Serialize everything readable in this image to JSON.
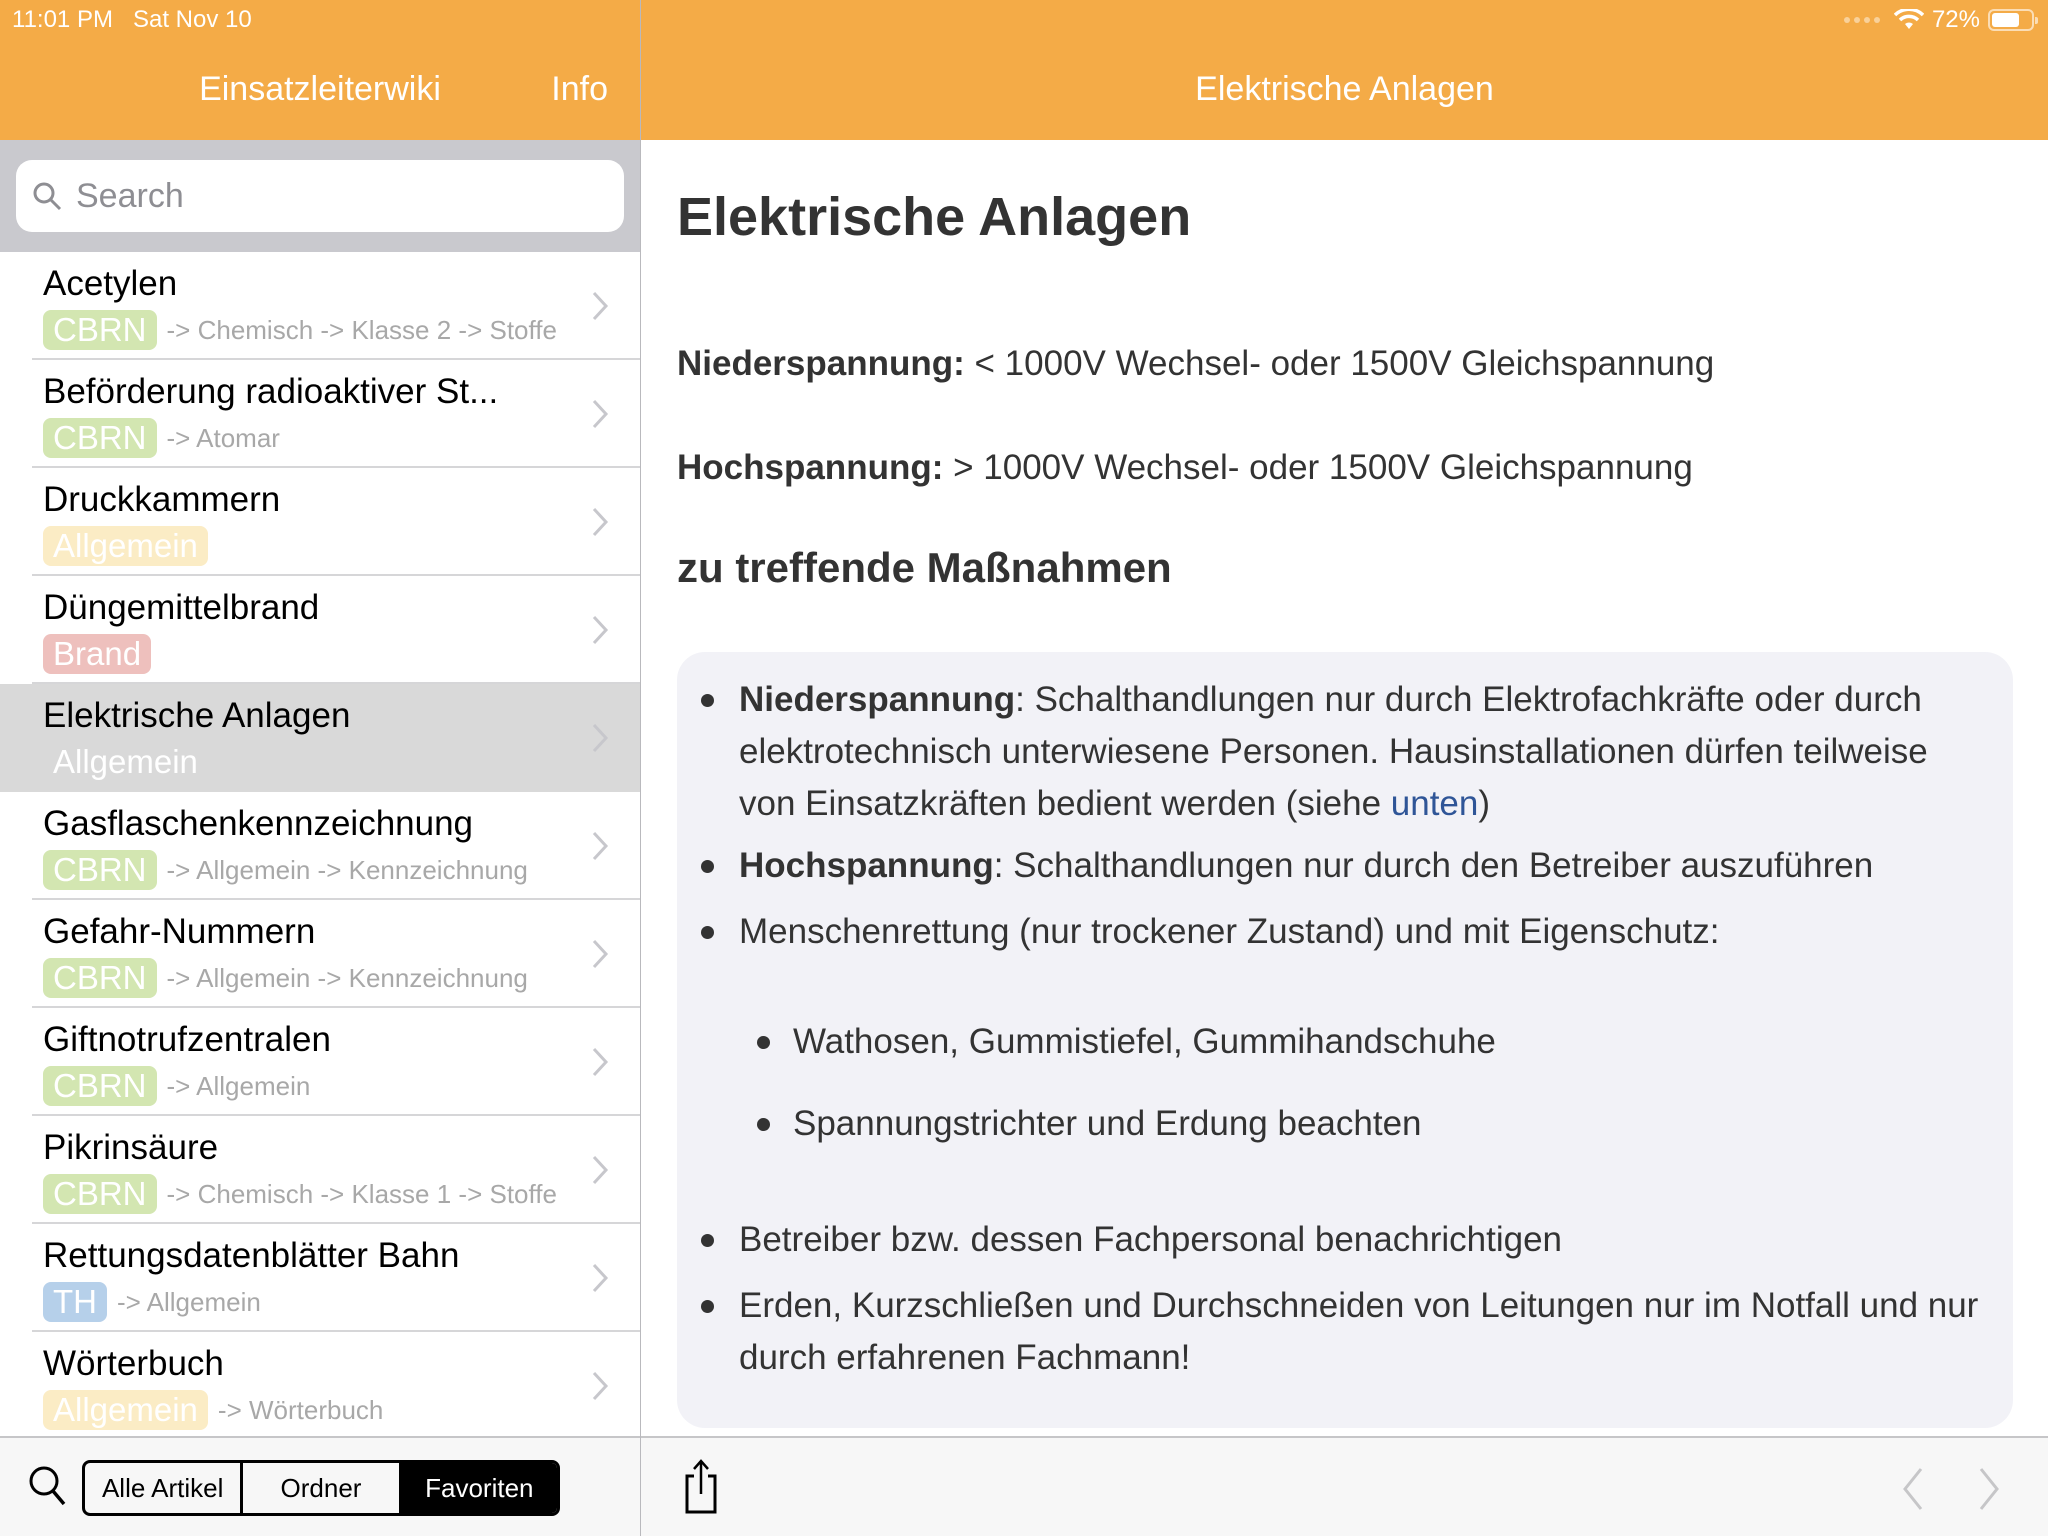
{
  "status_bar": {
    "time": "11:01 PM",
    "date": "Sat Nov 10",
    "battery": "72%",
    "battery_level": 0.72
  },
  "left_nav": {
    "title": "Einsatzleiterwiki",
    "info_button": "Info"
  },
  "search": {
    "placeholder": "Search",
    "value": ""
  },
  "articles": [
    {
      "name": "Acetylen",
      "tag": "CBRN",
      "tag_color": "#d3e6b1",
      "path": "-> Chemisch -> Klasse 2 -> Stoffe",
      "selected": false
    },
    {
      "name": "Beförderung radioaktiver St...",
      "tag": "CBRN",
      "tag_color": "#d3e6b1",
      "path": "-> Atomar",
      "selected": false
    },
    {
      "name": "Druckkammern",
      "tag": "Allgemein",
      "tag_color": "#fbecc5",
      "path": "",
      "selected": false
    },
    {
      "name": "Düngemittelbrand",
      "tag": "Brand",
      "tag_color": "#eec0bd",
      "path": "",
      "selected": false
    },
    {
      "name": "Elektrische Anlagen",
      "tag": "Allgemein",
      "tag_color": "transparent",
      "path": "",
      "selected": true
    },
    {
      "name": "Gasflaschenkennzeichnung",
      "tag": "CBRN",
      "tag_color": "#d3e6b1",
      "path": "-> Allgemein -> Kennzeichnung",
      "selected": false
    },
    {
      "name": "Gefahr-Nummern",
      "tag": "CBRN",
      "tag_color": "#d3e6b1",
      "path": "-> Allgemein -> Kennzeichnung",
      "selected": false
    },
    {
      "name": "Giftnotrufzentralen",
      "tag": "CBRN",
      "tag_color": "#d3e6b1",
      "path": "-> Allgemein",
      "selected": false
    },
    {
      "name": "Pikrinsäure",
      "tag": "CBRN",
      "tag_color": "#d3e6b1",
      "path": "-> Chemisch -> Klasse 1 -> Stoffe",
      "selected": false
    },
    {
      "name": "Rettungsdatenblätter Bahn",
      "tag": "TH",
      "tag_color": "#b6d0ea",
      "path": "-> Allgemein",
      "selected": false
    },
    {
      "name": "Wörterbuch",
      "tag": "Allgemein",
      "tag_color": "#fbecc5",
      "path": "-> Wörterbuch",
      "selected": false
    }
  ],
  "bottom_tabs": {
    "tabs": [
      "Alle Artikel",
      "Ordner",
      "Favoriten"
    ],
    "selected": "Favoriten"
  },
  "detail": {
    "nav_title": "Elektrische Anlagen",
    "title": "Elektrische Anlagen",
    "low_label": "Niederspannung:",
    "low_text": " < 1000V Wechsel- oder 1500V Gleichspannung",
    "high_label": "Hochspannung:",
    "high_text": " > 1000V Wechsel- oder 1500V Gleichspannung",
    "section": "zu treffende Maßnahmen",
    "b1_label": "Niederspannung",
    "b1_text": ": Schalthandlungen nur durch Elektrofachkräfte oder durch elektrotechnisch unterwiesene Personen. Hausinstallationen dürfen teilweise von Einsatzkräften bedient werden (siehe ",
    "b1_link": "unten",
    "b1_end": ")",
    "b2_label": "Hochspannung",
    "b2_text": ": Schalthandlungen nur durch den Betreiber auszuführen",
    "b3": "Menschenrettung (nur trockener Zustand) und mit Eigenschutz:",
    "b3a": "Wathosen, Gummistiefel, Gummihandschuhe",
    "b3b": "Spannungstrichter und Erdung beachten",
    "b4": "Betreiber bzw. dessen Fachpersonal benachrichtigen",
    "b5": "Erden, Kurzschließen und Durchschneiden von Leitungen nur im Notfall und nur durch erfahrenen Fachmann!"
  },
  "colors": {
    "accent": "#f4ab47",
    "link": "#2f5597"
  }
}
